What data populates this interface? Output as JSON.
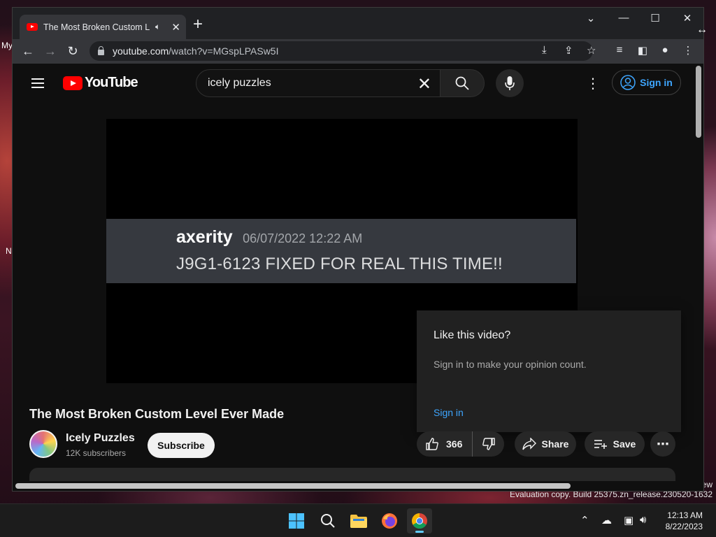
{
  "desktop": {
    "labels": [
      "My",
      "N"
    ],
    "eval_new": "ew",
    "eval_text": "Evaluation copy. Build 25375.zn_release.230520-1632"
  },
  "browser": {
    "tab": {
      "title": "The Most Broken Custom Level Ever Made"
    },
    "address": {
      "host": "youtube.com",
      "path": "/watch?v=MGspLPASw5I"
    }
  },
  "youtube": {
    "logo_text": "YouTube",
    "search": {
      "query": "icely puzzles"
    },
    "signin_label": "Sign in",
    "video": {
      "caption_user": "axerity",
      "caption_time": "06/07/2022 12:22 AM",
      "caption_message": "J9G1-6123 FIXED FOR REAL THIS TIME!!"
    },
    "popup": {
      "title": "Like this video?",
      "body": "Sign in to make your opinion count.",
      "link": "Sign in"
    },
    "title": "The Most Broken Custom Level Ever Made",
    "channel": {
      "name": "Icely Puzzles",
      "subscribers": "12K subscribers"
    },
    "subscribe_label": "Subscribe",
    "actions": {
      "likes": "366",
      "share": "Share",
      "save": "Save"
    }
  },
  "taskbar": {
    "time": "12:13 AM",
    "date": "8/22/2023"
  },
  "colors": {
    "youtube_red": "#ff0000",
    "link_blue": "#3ea6ff",
    "accent": "#60cdff"
  }
}
